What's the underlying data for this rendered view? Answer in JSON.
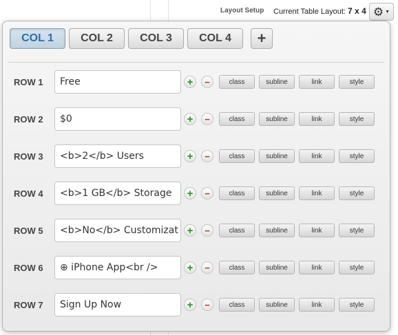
{
  "header": {
    "layout_setup": "Layout Setup",
    "current_layout_label": "Current Table Layout:",
    "current_layout_value": "7 x 4",
    "gear_icon": "gear-icon",
    "caret_icon": "caret-down-icon"
  },
  "columns": {
    "tabs": [
      "COL 1",
      "COL 2",
      "COL 3",
      "COL 4"
    ],
    "active": "COL 1",
    "add_label": "+"
  },
  "rows": [
    {
      "label": "ROW 1",
      "value": "Free"
    },
    {
      "label": "ROW 2",
      "value": "$0"
    },
    {
      "label": "ROW 3",
      "value": "<b>2</b> Users"
    },
    {
      "label": "ROW 4",
      "value": "<b>1 GB</b> Storage"
    },
    {
      "label": "ROW 5",
      "value": "<b>No</b> Customizat"
    },
    {
      "label": "ROW 6",
      "value": "⊕ iPhone App<br />"
    },
    {
      "label": "ROW 7",
      "value": "Sign Up Now"
    }
  ],
  "row_buttons": {
    "plus": "+",
    "minus": "−",
    "class": "class",
    "subline": "subline",
    "link": "link",
    "style": "style"
  },
  "colors": {
    "active_tab_text": "#2a6fa8",
    "plus": "#1f9a1f",
    "minus": "#c72b2b"
  }
}
